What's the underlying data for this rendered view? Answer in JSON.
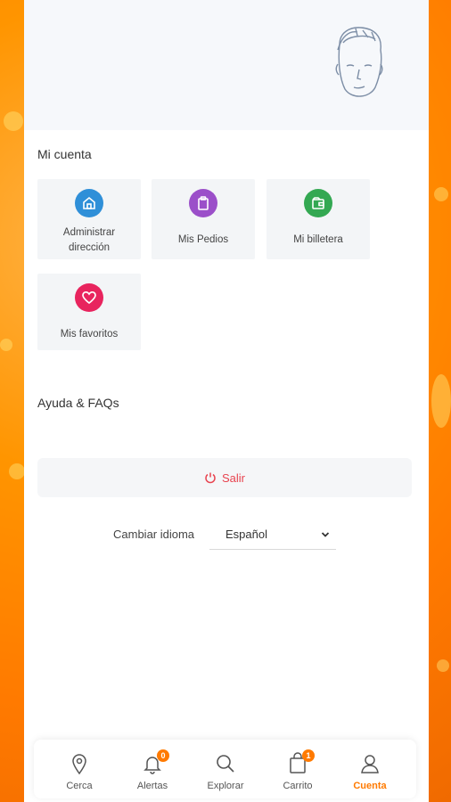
{
  "account": {
    "section_title": "Mi cuenta",
    "tiles": [
      {
        "label": "Administrar dirección",
        "icon": "home-icon",
        "color": "#2f8fd8"
      },
      {
        "label": "Mis Pedios",
        "icon": "clipboard-icon",
        "color": "#9b4fc9"
      },
      {
        "label": "Mi billetera",
        "icon": "wallet-icon",
        "color": "#33a852"
      },
      {
        "label": "Mis favoritos",
        "icon": "heart-icon",
        "color": "#e8245e"
      }
    ]
  },
  "help": {
    "title": "Ayuda & FAQs"
  },
  "logout": {
    "label": "Salir",
    "color": "#e8434f"
  },
  "language": {
    "label": "Cambiar idioma",
    "selected": "Español"
  },
  "nav": {
    "items": [
      {
        "label": "Cerca",
        "icon": "location-pin-icon"
      },
      {
        "label": "Alertas",
        "icon": "bell-icon",
        "badge": "0"
      },
      {
        "label": "Explorar",
        "icon": "search-icon"
      },
      {
        "label": "Carrito",
        "icon": "cart-icon",
        "badge": "1"
      },
      {
        "label": "Cuenta",
        "icon": "user-icon",
        "active": true
      }
    ],
    "accent": "#ff7a00"
  }
}
